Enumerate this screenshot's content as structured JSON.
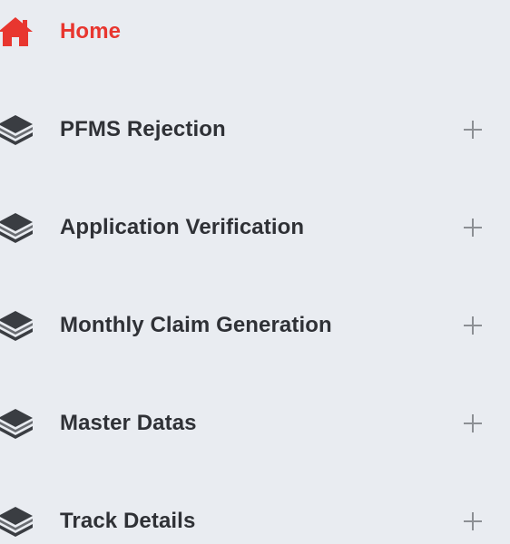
{
  "menu": {
    "items": [
      {
        "label": "Home",
        "icon": "home-icon",
        "active": true,
        "expandable": false
      },
      {
        "label": "PFMS Rejection",
        "icon": "layers-icon",
        "active": false,
        "expandable": true,
        "expand_icon": "plus-icon"
      },
      {
        "label": "Application Verification",
        "icon": "layers-icon",
        "active": false,
        "expandable": true,
        "expand_icon": "plus-icon"
      },
      {
        "label": "Monthly Claim Generation",
        "icon": "layers-icon",
        "active": false,
        "expandable": true,
        "expand_icon": "plus-icon"
      },
      {
        "label": "Master Datas",
        "icon": "layers-icon",
        "active": false,
        "expandable": true,
        "expand_icon": "plus-icon"
      },
      {
        "label": "Track Details",
        "icon": "layers-icon",
        "active": false,
        "expandable": true,
        "expand_icon": "plus-icon"
      }
    ]
  },
  "colors": {
    "background": "#e9ecf1",
    "active": "#e8362f",
    "text": "#2f3136",
    "icon": "#3a3d42",
    "plus": "#8c8f94"
  }
}
